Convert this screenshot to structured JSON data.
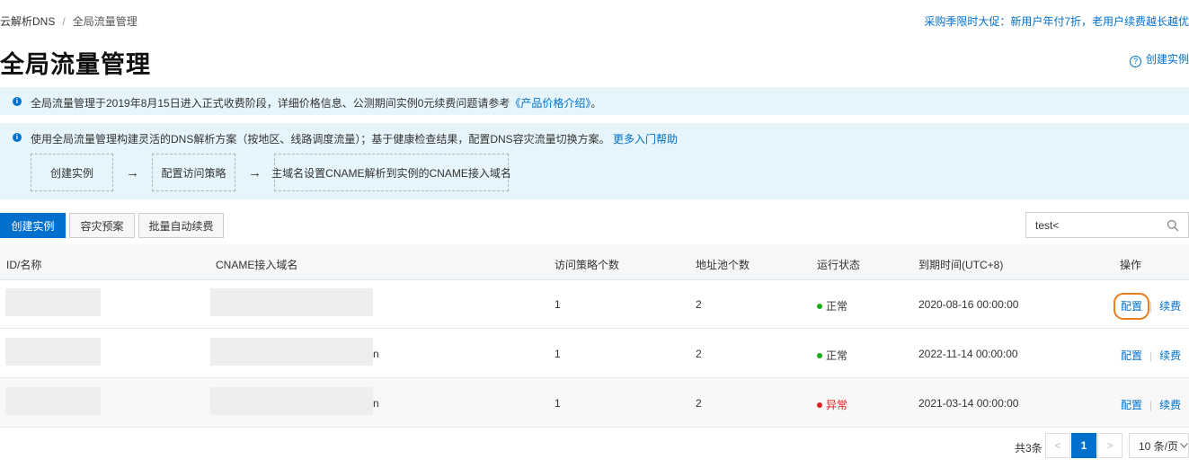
{
  "breadcrumb": {
    "root": "云解析DNS",
    "separator": "/",
    "current": "全局流量管理"
  },
  "promo": "采购季限时大促：新用户年付7折，老用户续费越长越优",
  "page_title": "全局流量管理",
  "create_top": {
    "icon": "help-circle-icon",
    "label": "创建实例"
  },
  "notice1": {
    "text": "全局流量管理于2019年8月15日进入正式收费阶段，详细价格信息、公测期间实例0元续费问题请参考",
    "link": "《产品价格介绍》",
    "suffix": "。"
  },
  "notice2": {
    "text": "使用全局流量管理构建灵活的DNS解析方案（按地区、线路调度流量）；基于健康检查结果，配置DNS容灾流量切换方案。",
    "link": "更多入门帮助",
    "steps": [
      "创建实例",
      "配置访问策略",
      "主域名设置CNAME解析到实例的CNAME接入域名"
    ],
    "arrow": "→"
  },
  "toolbar": {
    "create": "创建实例",
    "dr": "容灾预案",
    "renew": "批量自动续费",
    "search_value": "test<"
  },
  "table": {
    "headers": [
      "ID/名称",
      "CNAME接入域名",
      "访问策略个数",
      "地址池个数",
      "运行状态",
      "到期时间(UTC+8)",
      "操作"
    ],
    "rows": [
      {
        "cname_tail": "",
        "policies": "1",
        "pools": "2",
        "status": "正常",
        "expiry": "2020-08-16 00:00:00"
      },
      {
        "cname_tail": "n",
        "policies": "1",
        "pools": "2",
        "status": "正常",
        "expiry": "2022-11-14 00:00:00"
      },
      {
        "cname_tail": "n",
        "policies": "1",
        "pools": "2",
        "status": "异常",
        "expiry": "2021-03-14 00:00:00"
      }
    ],
    "ops": {
      "config": "配置",
      "renew": "续费",
      "separator": "|"
    }
  },
  "pagination": {
    "total": "共3条",
    "prev": "<",
    "current": "1",
    "next": ">",
    "page_size": "10 条/页"
  },
  "colors": {
    "accent": "#0070cc",
    "ok": "#1aad19",
    "error": "#e02020",
    "focus": "#e8801f"
  }
}
